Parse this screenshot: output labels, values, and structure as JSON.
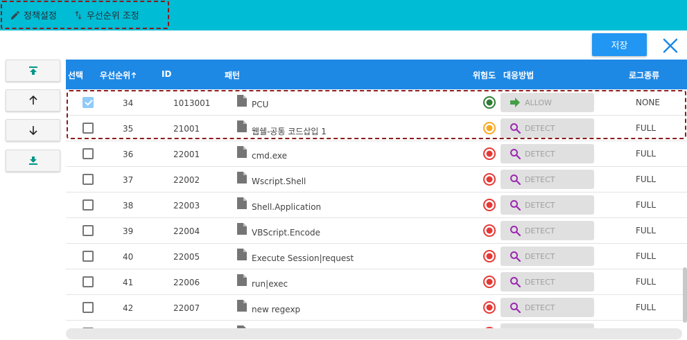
{
  "top_tabs": [
    {
      "label": "정책설정",
      "icon": "pencil-icon"
    },
    {
      "label": "우선순위 조정",
      "icon": "sort-arrows-icon"
    }
  ],
  "toolbar": {
    "save_label": "저장",
    "close_icon": "close-icon"
  },
  "side_buttons": [
    {
      "icon": "move-to-top-icon"
    },
    {
      "icon": "arrow-up-icon"
    },
    {
      "icon": "arrow-down-icon"
    },
    {
      "icon": "move-to-bottom-icon"
    }
  ],
  "table": {
    "headers": {
      "select": "선택",
      "priority": "우선순위",
      "id": "ID",
      "pattern": "패턴",
      "risk": "위험도",
      "action": "대응방법",
      "log": "로그종류"
    },
    "rows": [
      {
        "checked": true,
        "priority": "34",
        "id": "1013001",
        "pattern": "PCU",
        "risk": "low",
        "action": "ALLOW",
        "action_icon": "arrow-right-icon",
        "log": "NONE"
      },
      {
        "checked": false,
        "priority": "35",
        "id": "21001",
        "pattern": "웹쉘-공통 코드삽입 1",
        "risk": "medium",
        "action": "DETECT",
        "action_icon": "search-icon",
        "log": "FULL"
      },
      {
        "checked": false,
        "priority": "36",
        "id": "22001",
        "pattern": "cmd.exe",
        "risk": "high",
        "action": "DETECT",
        "action_icon": "search-icon",
        "log": "FULL"
      },
      {
        "checked": false,
        "priority": "37",
        "id": "22002",
        "pattern": "Wscript.Shell",
        "risk": "high",
        "action": "DETECT",
        "action_icon": "search-icon",
        "log": "FULL"
      },
      {
        "checked": false,
        "priority": "38",
        "id": "22003",
        "pattern": "Shell.Application",
        "risk": "high",
        "action": "DETECT",
        "action_icon": "search-icon",
        "log": "FULL"
      },
      {
        "checked": false,
        "priority": "39",
        "id": "22004",
        "pattern": "VBScript.Encode",
        "risk": "high",
        "action": "DETECT",
        "action_icon": "search-icon",
        "log": "FULL"
      },
      {
        "checked": false,
        "priority": "40",
        "id": "22005",
        "pattern": "Execute Session|request",
        "risk": "high",
        "action": "DETECT",
        "action_icon": "search-icon",
        "log": "FULL"
      },
      {
        "checked": false,
        "priority": "41",
        "id": "22006",
        "pattern": "run|exec",
        "risk": "high",
        "action": "DETECT",
        "action_icon": "search-icon",
        "log": "FULL"
      },
      {
        "checked": false,
        "priority": "42",
        "id": "22007",
        "pattern": "new regexp",
        "risk": "high",
        "action": "DETECT",
        "action_icon": "search-icon",
        "log": "FULL"
      }
    ]
  },
  "colors": {
    "topbar": "#00bcd4",
    "header": "#1e88e5",
    "save": "#2196f3",
    "risk_low": "#2e7d32",
    "risk_medium": "#f9a825",
    "risk_high": "#e53935",
    "allow_icon": "#43a047",
    "detect_icon": "#9c27b0"
  }
}
